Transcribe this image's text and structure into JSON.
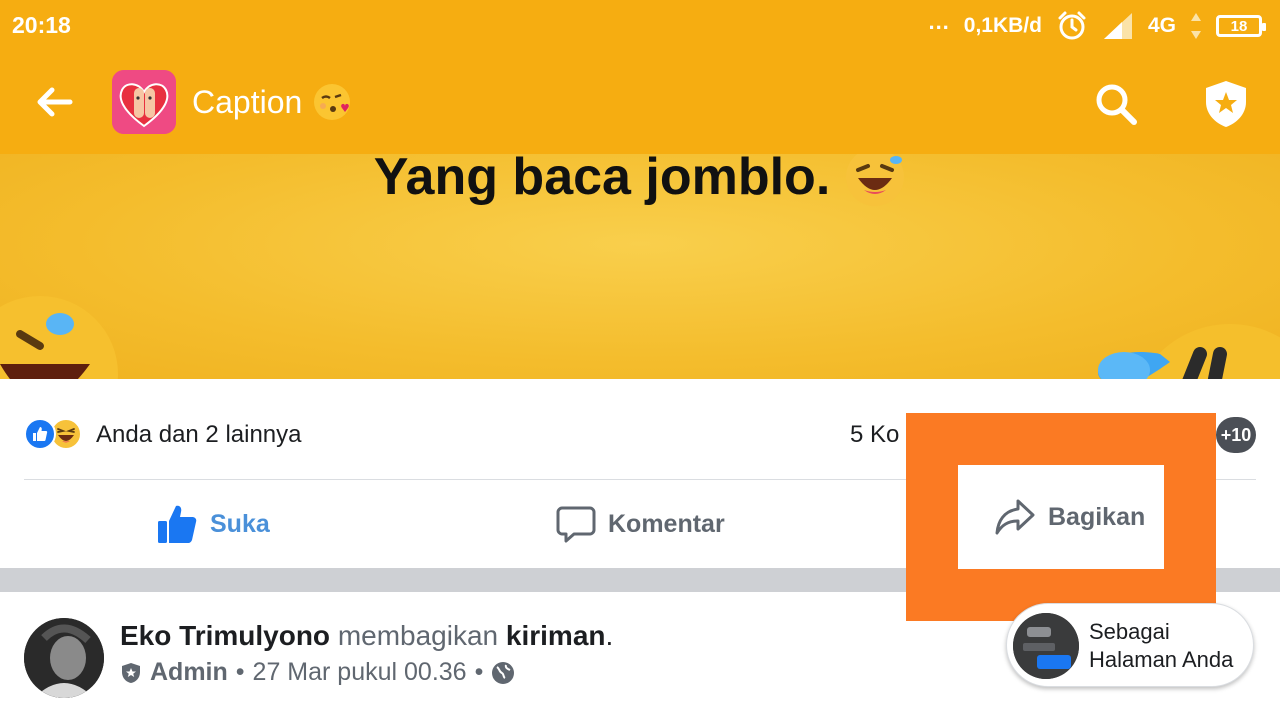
{
  "status_bar": {
    "time": "20:18",
    "dots": "...",
    "net_speed": "0,1KB/d",
    "network": "4G",
    "battery": "18"
  },
  "app_bar": {
    "title": "Caption",
    "icons": [
      "back-arrow-icon",
      "app-logo",
      "search-icon",
      "shield-star-icon"
    ]
  },
  "post_image": {
    "text": "Yang baca jomblo."
  },
  "reactions": {
    "summary": "Anda dan 2 lainnya",
    "comments_partial": "5 Ko",
    "more_badge": "+10"
  },
  "actions": {
    "like": "Suka",
    "comment": "Komentar",
    "share": "Bagikan"
  },
  "next_post": {
    "author": "Eko Trimulyono",
    "verb": "membagikan",
    "object": "kiriman",
    "period": ".",
    "role": "Admin",
    "date": "27 Mar pukul 00.36",
    "dot": "•"
  },
  "post_as": {
    "line1": "Sebagai",
    "line2": "Halaman Anda"
  },
  "colors": {
    "app_bar": "#f6ad11",
    "highlight": "#fb7a23",
    "like_blue": "#4a90d9",
    "text_secondary": "#606770"
  }
}
